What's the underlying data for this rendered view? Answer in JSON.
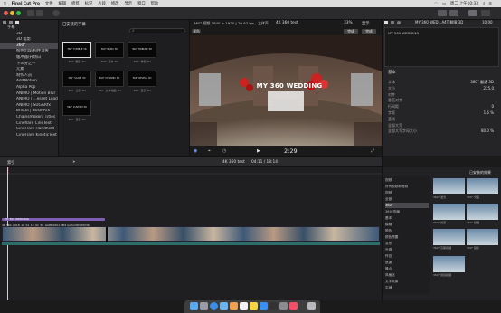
{
  "menubar": {
    "items": [
      "Final Cut Pro",
      "文件",
      "编辑",
      "修剪",
      "标记",
      "片段",
      "修改",
      "显示",
      "窗口",
      "帮助"
    ],
    "clock": "周二 上午10:33"
  },
  "sidebar": {
    "items": [
      {
        "label": "字幕",
        "selected": false
      },
      {
        "label": "3D",
        "selected": false
      },
      {
        "label": "3D 电影",
        "selected": false
      },
      {
        "label": "360°",
        "selected": true
      },
      {
        "label": "构件出现/构件消失",
        "selected": false
      },
      {
        "label": "缓冲器/开场白",
        "selected": false
      },
      {
        "label": "下三分之一",
        "selected": false
      },
      {
        "label": "元素",
        "selected": false
      },
      {
        "label": "制作人员",
        "selected": false
      },
      {
        "label": "AddMotion",
        "selected": false
      },
      {
        "label": "Alpha Pop",
        "selected": false
      },
      {
        "label": "ANIMO | Motion Blur",
        "selected": false
      },
      {
        "label": "ANIMO | ...esset Loader",
        "selected": false
      },
      {
        "label": "ANIMO | SUGARfx",
        "selected": false
      },
      {
        "label": "Bristol | SUGARfx",
        "selected": false
      },
      {
        "label": "Chainsmokers Titles",
        "selected": false
      },
      {
        "label": "Cineflare CineText",
        "selected": false
      },
      {
        "label": "CineFlare Handheld",
        "selected": false
      },
      {
        "label": "CineFlare KineticText",
        "selected": false
      }
    ]
  },
  "browser": {
    "filter_label": "已安装的字幕",
    "search_placeholder": "",
    "thumbnails": [
      {
        "title": "360° TUMBLE 3D",
        "label": "360° 翻滚 3D",
        "selected": true
      },
      {
        "title": "360° BASIC 3D",
        "label": "360° 基本 3D",
        "selected": false
      },
      {
        "title": "360° TRIBUNE 3D",
        "label": "360° 体积 3D",
        "selected": false
      },
      {
        "title": "360° SCALE 3D",
        "label": "360° 比例 3D",
        "selected": false
      },
      {
        "title": "360° DYNAMIC 3D",
        "label": "360° 文本动画 3D",
        "selected": false
      },
      {
        "title": "360° REVEAL 3D",
        "label": "360° 显示 3D",
        "selected": false
      },
      {
        "title": "360° CUSTOM 3D",
        "label": "360° 自定 3D",
        "selected": false
      }
    ]
  },
  "viewer": {
    "format": "360° 视频 3840 × 1920 | 29.97 fps，立体声",
    "project": "4K 360 test",
    "zoom": "33%",
    "view_menu": "显示",
    "overlay_text": "MY 360 WEDDING",
    "done_button": "完成",
    "angle_button": "视角",
    "timecode": "2:29"
  },
  "inspector": {
    "title": "MY 360 WED...A4T 翻滚 3D",
    "duration": "10:00",
    "preview_text": "MY 360 WEDDING",
    "section": "基本",
    "rows": [
      {
        "label": "字体",
        "value": "360° 翻滚 3D"
      },
      {
        "label": "大小",
        "value": "225.0"
      },
      {
        "label": "对齐",
        "value": ""
      },
      {
        "label": "垂直对齐",
        "value": ""
      },
      {
        "label": "行间距",
        "value": "0"
      },
      {
        "label": "字距",
        "value": "1.6 %"
      },
      {
        "label": "基线",
        "value": ""
      },
      {
        "label": "全部大写",
        "value": ""
      },
      {
        "label": "全部大写字母大小",
        "value": "80.0 %"
      }
    ]
  },
  "timeline_bar": {
    "index_label": "索引",
    "project": "4K 360 test",
    "duration": "04:11 / 18:14"
  },
  "timeline": {
    "title_clip": "MY 360 WEDDING",
    "video_clip": "4K 360_2018_10_01_12_01_50_GOPR0001.MP4 GoPro5DYZ9V3K"
  },
  "effects": {
    "title": "已安装的效果",
    "categories": [
      "视频",
      "所有视频和音频",
      "视频",
      "全部",
      "360°",
      "360°改编",
      "基本",
      "模糊",
      "颜色",
      "颜色预置",
      "变形",
      "光源",
      "怀旧",
      "遮罩",
      "噪点",
      "风格化",
      "文字效果",
      "平铺"
    ],
    "items": [
      {
        "label": "360° 发光"
      },
      {
        "label": "360° 光晕"
      },
      {
        "label": "360° 光束"
      },
      {
        "label": "360° 模糊"
      },
      {
        "label": "360° 高斯模糊"
      },
      {
        "label": "360° 锐化"
      },
      {
        "label": "360° 通道模糊"
      }
    ]
  }
}
